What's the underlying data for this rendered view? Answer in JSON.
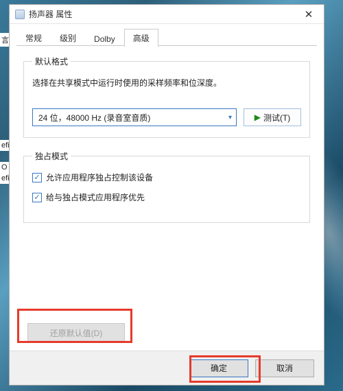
{
  "window": {
    "title": "扬声器 属性"
  },
  "tabs": {
    "general": "常规",
    "levels": "级别",
    "dolby": "Dolby",
    "advanced": "高级"
  },
  "default_format": {
    "legend": "默认格式",
    "description": "选择在共享模式中运行时使用的采样频率和位深度。",
    "selected": "24 位，48000 Hz (录音室音质)",
    "test_label": "测试(T)"
  },
  "exclusive_mode": {
    "legend": "独占模式",
    "allow_exclusive": "允许应用程序独占控制该设备",
    "priority": "给与独占模式应用程序优先"
  },
  "buttons": {
    "restore_defaults": "还原默认值(D)",
    "ok": "确定",
    "cancel": "取消"
  },
  "background_fragments": {
    "a": "言",
    "b": "efi",
    "c": "O",
    "d": "efi"
  }
}
